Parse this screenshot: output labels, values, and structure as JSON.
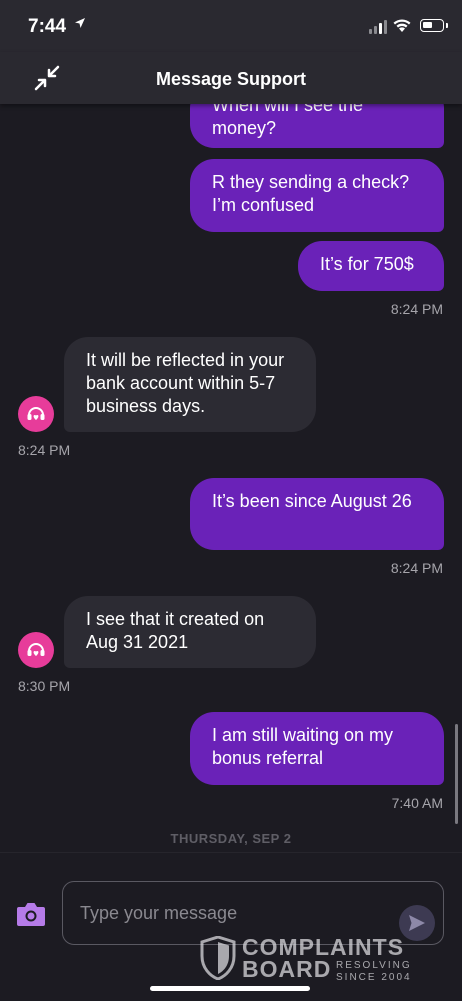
{
  "status_bar": {
    "time": "7:44"
  },
  "header": {
    "title": "Message Support"
  },
  "messages": [
    {
      "text": "When will I see the money?"
    },
    {
      "text": "R they sending a check? I’m confused"
    },
    {
      "text": "It’s for 750$"
    },
    {
      "timestamp": "8:24 PM"
    },
    {
      "text": "It will be reflected in your bank account within 5-7 business days.",
      "timestamp": "8:24 PM"
    },
    {
      "text": "It’s been since August 26",
      "timestamp": "8:24 PM"
    },
    {
      "text": "I see that it created on Aug 31 2021",
      "timestamp": "8:30 PM"
    },
    {
      "text": "I am still waiting on my bonus referral",
      "timestamp": "7:40 AM"
    }
  ],
  "day_separator": "THURSDAY, SEP 2",
  "composer": {
    "placeholder": "Type your message"
  },
  "watermark": {
    "line1": "COMPLAINTS",
    "line2": "BOARD",
    "tag1": "RESOLVING",
    "tag2": "SINCE 2004"
  },
  "colors": {
    "outgoing_bubble": "#6a22b8",
    "incoming_bubble": "#2c2b33",
    "avatar": "#e73c9a",
    "background": "#1c1b22"
  }
}
